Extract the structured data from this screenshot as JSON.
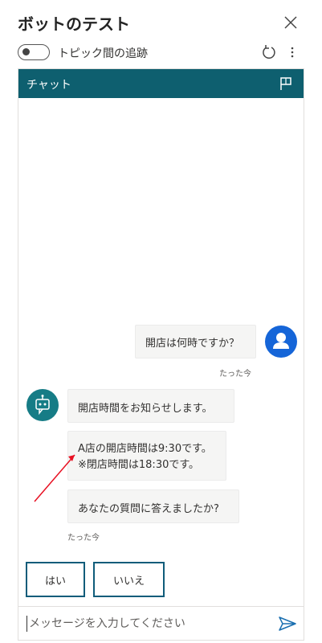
{
  "header": {
    "title": "ボットのテスト"
  },
  "toolbar": {
    "toggle_label": "トピック間の追跡"
  },
  "chat": {
    "title": "チャット",
    "messages": [
      {
        "from": "user",
        "text": "開店は何時ですか？",
        "time": "たった今"
      },
      {
        "from": "bot",
        "lines": [
          "開店時間をお知らせします。",
          "A店の開店時間は9:30です。",
          "※閉店時間は18:30です。",
          "あなたの質問に答えましたか?"
        ],
        "time": "たった今"
      }
    ],
    "quick_replies": [
      "はい",
      "いいえ"
    ],
    "input_placeholder": "メッセージを入力してください"
  },
  "colors": {
    "header_bg": "#0e5f6f",
    "user_avatar": "#1565d8",
    "bot_avatar": "#167c86",
    "button_border": "#0f5c7a",
    "arrow": "#e81123"
  }
}
